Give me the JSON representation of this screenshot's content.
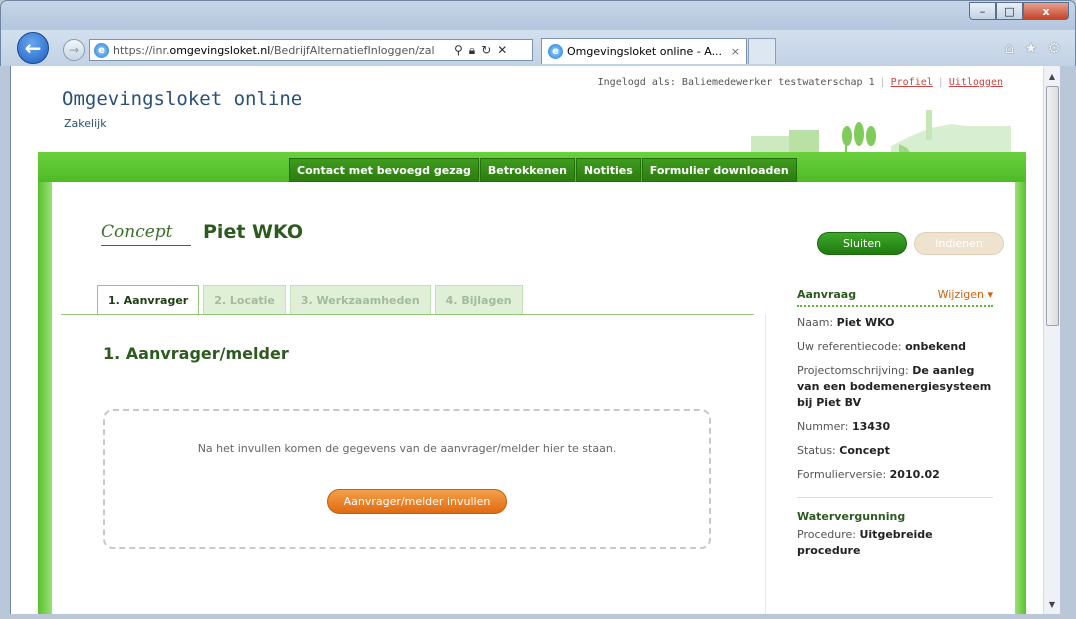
{
  "browser": {
    "url_prefix": "https://inr.",
    "url_domain": "omgevingsloket.nl",
    "url_path": "/BedrijfAlternatiefInloggen/zal",
    "tab_title": "Omgevingsloket online - A...",
    "tab_close": "×",
    "win_minimize": "–",
    "win_maximize": "□",
    "win_close": "x"
  },
  "site": {
    "title": "Omgevingsloket online",
    "subtitle": "Zakelijk",
    "logged_in_text": "Ingelogd als: Baliemedewerker testwaterschap 1",
    "profile_link": "Profiel",
    "logout_link": "Uitloggen"
  },
  "topnav": [
    {
      "label": "Contact met bevoegd gezag"
    },
    {
      "label": "Betrokkenen"
    },
    {
      "label": "Notities"
    },
    {
      "label": "Formulier downloaden"
    }
  ],
  "header": {
    "concept_tag": "Concept",
    "title": "Piet WKO",
    "close_button": "Sluiten",
    "submit_button": "Indienen"
  },
  "tabs": [
    {
      "label": "1. Aanvrager",
      "active": true
    },
    {
      "label": "2. Locatie",
      "active": false
    },
    {
      "label": "3. Werkzaamheden",
      "active": false
    },
    {
      "label": "4. Bijlagen",
      "active": false
    }
  ],
  "main": {
    "section_title": "1. Aanvrager/melder",
    "placeholder_text": "Na het invullen komen de gegevens van de aanvrager/melder hier te staan.",
    "fill_button": "Aanvrager/melder invullen"
  },
  "sidebar": {
    "heading": "Aanvraag",
    "edit_link": "Wijzigen ▾",
    "rows": [
      {
        "label": "Naam:",
        "value": "Piet WKO"
      },
      {
        "label": "Uw referentiecode:",
        "value": "onbekend"
      },
      {
        "label": "Projectomschrijving:",
        "value": "De aanleg van een bodemenergiesysteem bij Piet BV"
      },
      {
        "label": "Nummer:",
        "value": "13430"
      },
      {
        "label": "Status:",
        "value": "Concept"
      },
      {
        "label": "Formulierversie:",
        "value": "2010.02"
      }
    ],
    "section2_heading": "Watervergunning",
    "procedure_label": "Procedure:",
    "procedure_value": "Uitgebreide procedure"
  },
  "colors": {
    "brand_green": "#4eba26",
    "nav_dark_green": "#2c7d10",
    "accent_orange": "#e06a10",
    "title_blue": "#2a5078"
  }
}
